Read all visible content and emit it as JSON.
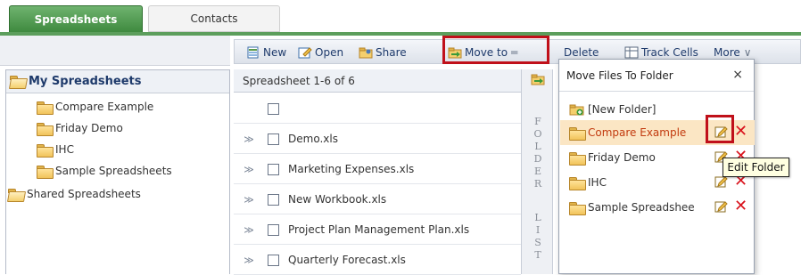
{
  "tabs": [
    "Spreadsheets",
    "Contacts"
  ],
  "sidebar": {
    "root": "My Spreadsheets",
    "items": [
      "Compare Example",
      "Friday Demo",
      "IHC",
      "Sample Spreadsheets"
    ],
    "shared": "Shared Spreadsheets"
  },
  "toolbar": {
    "new": "New",
    "open": "Open",
    "share": "Share",
    "move_to": "Move to",
    "delete": "Delete",
    "track_cells": "Track Cells",
    "more": "More"
  },
  "grid": {
    "header": "Spreadsheet 1-6 of 6",
    "files": [
      "Demo.xls",
      "Marketing Expenses.xls",
      "New Workbook.xls",
      "Project Plan Management Plan.xls",
      "Quarterly Forecast.xls"
    ]
  },
  "folder_list_letters": [
    "F",
    "O",
    "L",
    "D",
    "E",
    "R",
    "L",
    "I",
    "S",
    "T"
  ],
  "popup": {
    "title": "Move Files To Folder",
    "close": "×",
    "new_folder": "[New Folder]",
    "folders": [
      "Compare Example",
      "Friday Demo",
      "IHC",
      "Sample Spreadshee"
    ],
    "tooltip": "Edit Folder"
  },
  "colors": {
    "tab_active": "#4a9a4a",
    "highlight_row": "#fbe6c4",
    "highlight_text": "#c23a0e",
    "callout": "#c0101a",
    "delete": "#d9131c"
  }
}
